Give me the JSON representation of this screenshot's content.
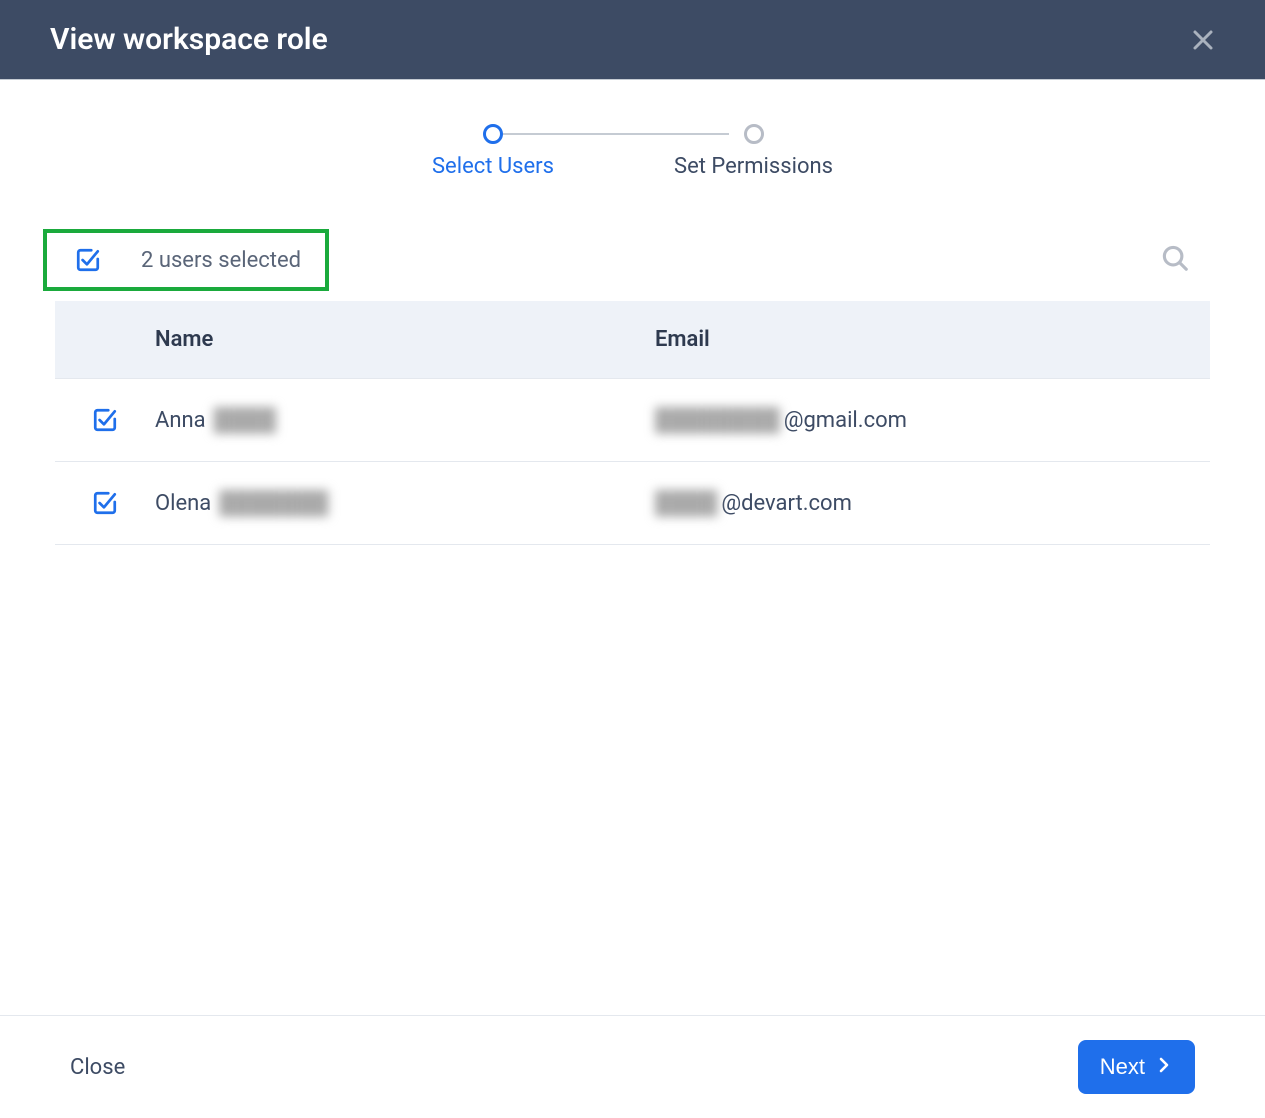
{
  "header": {
    "title": "View workspace role"
  },
  "stepper": {
    "step1_label": "Select Users",
    "step2_label": "Set Permissions"
  },
  "selection": {
    "selected_text": "2 users selected"
  },
  "table": {
    "columns": {
      "name": "Name",
      "email": "Email"
    },
    "rows": [
      {
        "name_visible": "Anna",
        "name_redacted": "████",
        "email_redacted": "████████",
        "email_visible": "@gmail.com"
      },
      {
        "name_visible": "Olena",
        "name_redacted": "███████",
        "email_redacted": "████",
        "email_visible": "@devart.com"
      }
    ]
  },
  "footer": {
    "close_label": "Close",
    "next_label": "Next"
  }
}
